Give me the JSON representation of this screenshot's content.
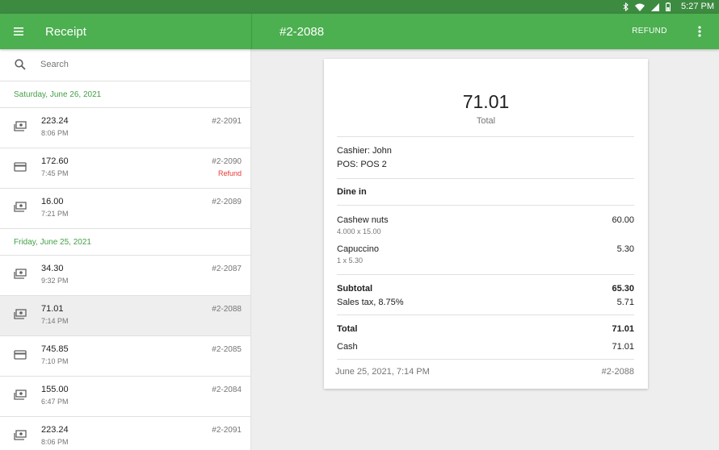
{
  "status_bar": {
    "time": "5:27 PM"
  },
  "app_bar": {
    "title": "Receipt",
    "receipt_number": "#2-2088",
    "refund_label": "REFUND"
  },
  "search": {
    "placeholder": "Search",
    "value": ""
  },
  "groups": [
    {
      "date": "Saturday, June 26, 2021",
      "rows": [
        {
          "amount": "223.24",
          "time": "8:06 PM",
          "number": "#2-2091",
          "status": "",
          "payment_icon": "cash-icon"
        },
        {
          "amount": "172.60",
          "time": "7:45 PM",
          "number": "#2-2090",
          "status": "Refund",
          "payment_icon": "card-icon"
        },
        {
          "amount": "16.00",
          "time": "7:21 PM",
          "number": "#2-2089",
          "status": "",
          "payment_icon": "cash-icon"
        }
      ]
    },
    {
      "date": "Friday, June 25, 2021",
      "rows": [
        {
          "amount": "34.30",
          "time": "9:32 PM",
          "number": "#2-2087",
          "status": "",
          "payment_icon": "cash-icon"
        },
        {
          "amount": "71.01",
          "time": "7:14 PM",
          "number": "#2-2088",
          "status": "",
          "payment_icon": "cash-icon",
          "selected": true
        },
        {
          "amount": "745.85",
          "time": "7:10 PM",
          "number": "#2-2085",
          "status": "",
          "payment_icon": "card-icon"
        },
        {
          "amount": "155.00",
          "time": "6:47 PM",
          "number": "#2-2084",
          "status": "",
          "payment_icon": "cash-icon"
        },
        {
          "amount": "223.24",
          "time": "8:06 PM",
          "number": "#2-2091",
          "status": "",
          "payment_icon": "cash-icon"
        }
      ]
    }
  ],
  "receipt": {
    "total_amount": "71.01",
    "total_caption": "Total",
    "cashier": "Cashier: John",
    "pos": "POS: POS 2",
    "dining_option": "Dine in",
    "items": [
      {
        "name": "Cashew nuts",
        "qty": "4.000 x 15.00",
        "price": "60.00"
      },
      {
        "name": "Capuccino",
        "qty": "1 x 5.30",
        "price": "5.30"
      }
    ],
    "subtotal_label": "Subtotal",
    "subtotal": "65.30",
    "tax_label": "Sales tax, 8.75%",
    "tax": "5.71",
    "total_label": "Total",
    "total": "71.01",
    "payment_label": "Cash",
    "payment": "71.01",
    "date_time": "June 25, 2021, 7:14 PM",
    "number": "#2-2088"
  },
  "colors": {
    "primary": "#4caf50",
    "status_bar": "#3d8b40",
    "date_header": "#43a047",
    "refund": "#e53935"
  }
}
